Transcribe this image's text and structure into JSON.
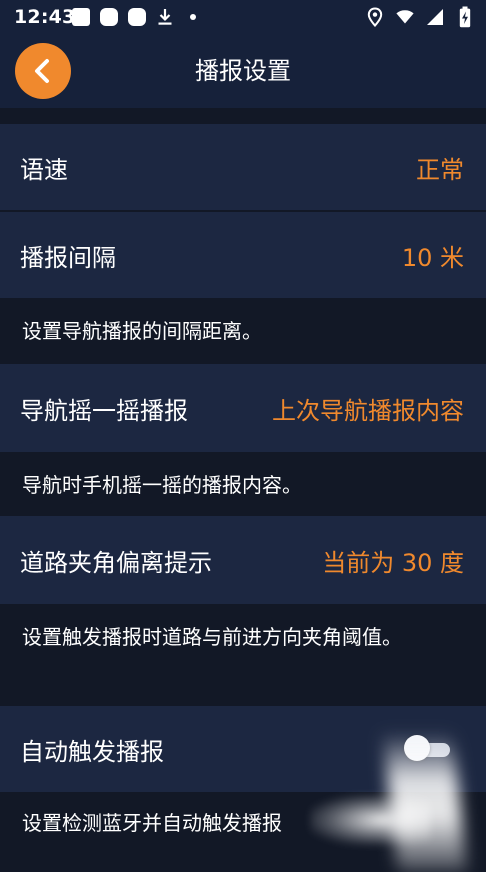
{
  "status_bar": {
    "time": "12:43",
    "left_icons": [
      "notification-square-icon",
      "notification-rounded-icon",
      "notification-rounded-icon",
      "download-icon",
      "dot-icon"
    ],
    "right_icons": [
      "location-icon",
      "wifi-icon",
      "signal-icon",
      "battery-charging-icon"
    ]
  },
  "header": {
    "title": "播报设置",
    "back_icon": "chevron-left-icon"
  },
  "rows": {
    "speed": {
      "label": "语速",
      "value": "正常"
    },
    "interval": {
      "label": "播报间隔",
      "value": "10 米",
      "description": "设置导航播报的间隔距离。"
    },
    "shake": {
      "label": "导航摇一摇播报",
      "value": "上次导航播报内容",
      "description": "导航时手机摇一摇的播报内容。"
    },
    "angle": {
      "label": "道路夹角偏离提示",
      "value": "当前为 30 度",
      "description": "设置触发播报时道路与前进方向夹角阈值。"
    },
    "auto": {
      "label": "自动触发播报",
      "toggle_on": false,
      "description": "设置检测蓝牙并自动触发播报"
    }
  },
  "colors": {
    "accent": "#f0892d",
    "background": "#121826",
    "row": "#1c2741",
    "header": "#16213a"
  }
}
